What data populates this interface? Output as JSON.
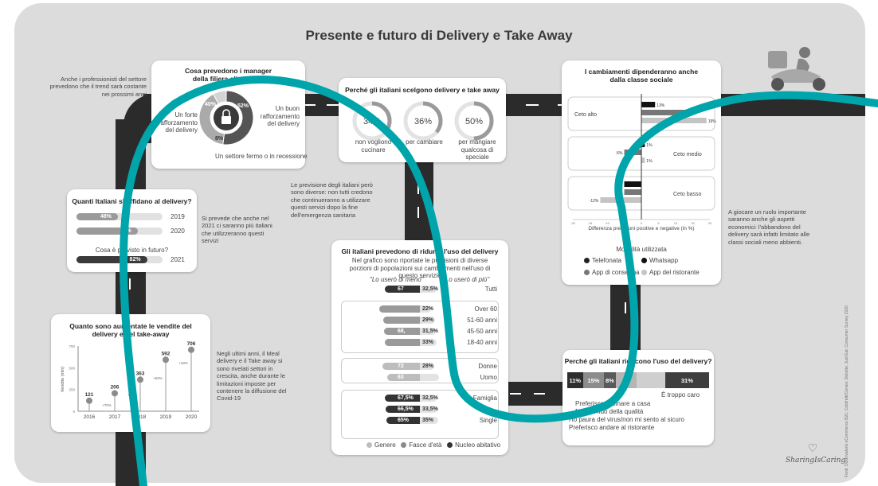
{
  "title": "Presente e futuro di Delivery e Take Away",
  "notes": {
    "professionals": "Anche i professionisti del settore prevedono che il trend sarà costante nei prossimi anni",
    "forecast_2021": "Si prevede che anche nel 2021 ci saranno più italiani che utilizzeranno questi servizi",
    "meal_delivery": "Negli ultimi anni, il Meal delivery e il Take away si sono rivelati settori in crescita, anche durante le limitazioni imposte per contenere la diffusione del Covid-19",
    "previsions": "Le previsione degli italiani però sono diverse: non tutti credono che continueranno a utilizzare questi servizi dopo la fine dell'emergenza sanitaria",
    "economic": "A giocare un ruolo importante saranno anche gli aspetti economici: l'abbandono del delivery sarà infatti limitato alle classi sociali meno abbienti."
  },
  "managers": {
    "title": "Cosa prevedono i manager della filiera alimentare",
    "slices": [
      {
        "label": "Un buon rafforzamento del delivery",
        "value": "52%",
        "color": "#555555"
      },
      {
        "label": "Un forte rafforzamento del delivery",
        "value": "40%",
        "color": "#aaaaaa"
      },
      {
        "label": "Un settore fermo o in recessione",
        "value": "8%",
        "color": "#d4d4d4"
      }
    ]
  },
  "reasons": {
    "title": "Perché gli italiani scelgono delivery e take away",
    "items": [
      {
        "value": "34%",
        "label": "non vogliono cucinare",
        "pct": 34
      },
      {
        "value": "36%",
        "label": "per cambiare",
        "pct": 36
      },
      {
        "value": "50%",
        "label": "per mangiare qualcosa di speciale",
        "pct": 50
      }
    ]
  },
  "trust": {
    "title": "Quanti Italiani si affidano al delivery?",
    "rows": [
      {
        "value": "48%",
        "year": "2019",
        "pct": 48,
        "color": "#9a9a9a"
      },
      {
        "value": "71%",
        "year": "2020",
        "pct": 71,
        "color": "#9a9a9a"
      },
      {
        "value": "82%",
        "year": "2021",
        "pct": 82,
        "color": "#3a3a3a"
      }
    ],
    "question": "Cosa è previsto in futuro?"
  },
  "sales": {
    "title": "Quanto sono aumentate le vendite del delivery e del take-away",
    "ylabel": "Vendite (mln)"
  },
  "future": {
    "title": "Gli italiani prevedono di ridurre l'uso del delivery",
    "subtitle": "Nel grafico sono riportate le previsioni di diverse porzioni di popolazioni sui cambiamenti nell'uso di questo servizio",
    "less_label": "\"Lo userò di meno\"",
    "more_label": "\"Lo userò di più\"",
    "legend": [
      "Genere",
      "Fasce d'età",
      "Nucleo abitativo"
    ]
  },
  "social": {
    "title": "I cambiamenti dipenderanno anche dalla classe sociale",
    "axis_label": "Differenza previsioni positive e negative (in %)",
    "legend_title": "Modalità utilizzata",
    "legend": [
      "Telefonata",
      "Whatsapp",
      "App di consegna",
      "App del ristorante"
    ]
  },
  "reduce": {
    "title": "Perché gli italiani riducono l'uso del delivery?",
    "segments": [
      {
        "value": "11%",
        "color": "#2e2e2e",
        "w": 11
      },
      {
        "value": "15%",
        "color": "#8c8c8c",
        "w": 15
      },
      {
        "value": "8%",
        "color": "#5a5a5a",
        "w": 8
      },
      {
        "value": "",
        "color": "#b5b5b5",
        "w": 15
      },
      {
        "value": "",
        "color": "#cfcfcf",
        "w": 20
      },
      {
        "value": "31%",
        "color": "#3e3e3e",
        "w": 31
      }
    ],
    "labels": [
      "È troppo caro",
      "Preferisco cucinare a casa",
      "Non mi fido della qualità",
      "Ho paura del virus/non mi sento al sicuro",
      "Preferisco andare al ristorante"
    ]
  },
  "brand": "SharingIsCaring",
  "source": "Fonti: Osservatorio eCommerce B2c; Coldiretti/Censis; Deloitte; Just Eat; Consumer Survey 2020",
  "chart_data": [
    {
      "type": "pie",
      "title": "Cosa prevedono i manager della filiera alimentare",
      "labels": [
        "Un buon rafforzamento del delivery",
        "Un forte rafforzamento del delivery",
        "Un settore fermo o in recessione"
      ],
      "values": [
        52,
        40,
        8
      ]
    },
    {
      "type": "bar",
      "title": "Quanti Italiani si affidano al delivery?",
      "categories": [
        "2019",
        "2020",
        "2021"
      ],
      "values": [
        48,
        71,
        82
      ]
    },
    {
      "type": "line",
      "title": "Quanto sono aumentate le vendite del delivery e del take-away",
      "ylabel": "Vendite (mln)",
      "x": [
        "2016",
        "2017",
        "2018",
        "2019",
        "2020"
      ],
      "values": [
        121,
        206,
        363,
        592,
        706
      ],
      "growth_labels": [
        "+70%",
        "+76%",
        "+63%",
        "+19%"
      ],
      "ylim": [
        0,
        750
      ],
      "yticks": [
        0,
        250,
        500,
        750
      ]
    },
    {
      "type": "bar",
      "title": "Gli italiani prevedono di ridurre l'uso del delivery",
      "groups": [
        {
          "group": "",
          "rows": [
            {
              "label": "Tutti",
              "less": 67.5,
              "more": 32.5,
              "less_text": "67",
              "more_text": "32,5%"
            }
          ]
        },
        {
          "group": "Fasce d'età",
          "rows": [
            {
              "label": "Over 60",
              "less": 78,
              "more": 22,
              "less_text": "",
              "more_text": "22%"
            },
            {
              "label": "51-60 anni",
              "less": 71,
              "more": 29,
              "less_text": "",
              "more_text": "29%"
            },
            {
              "label": "45-50 anni",
              "less": 68.5,
              "more": 31.5,
              "less_text": "68,",
              "more_text": "31,5%"
            },
            {
              "label": "18-40 anni",
              "less": 67,
              "more": 33,
              "less_text": "",
              "more_text": "33%"
            }
          ]
        },
        {
          "group": "Genere",
          "rows": [
            {
              "label": "Donne",
              "less": 72,
              "more": 28,
              "less_text": "72",
              "more_text": "28%"
            },
            {
              "label": "Uomo",
              "less": 63,
              "more": 37,
              "less_text": "63",
              "more_text": ""
            }
          ]
        },
        {
          "group": "Nucleo abitativo",
          "rows": [
            {
              "label": "Famiglia",
              "less": 67.5,
              "more": 32.5,
              "less_text": "67,5%",
              "more_text": "32,5%"
            },
            {
              "label": "",
              "less": 66.5,
              "more": 33.5,
              "less_text": "66,5%",
              "more_text": "33,5%"
            },
            {
              "label": "Single",
              "less": 65,
              "more": 35,
              "less_text": "65%",
              "more_text": "35%"
            }
          ]
        }
      ]
    },
    {
      "type": "bar",
      "title": "I cambiamenti dipenderanno anche dalla classe sociale",
      "categories": [
        "Ceto alto",
        "Ceto medio",
        "Ceto basso"
      ],
      "series": [
        {
          "name": "Telefonata",
          "values": [
            null,
            null,
            null
          ]
        },
        {
          "name": "Whatsapp",
          "values": [
            4,
            1,
            -5
          ]
        },
        {
          "name": "App di consegna",
          "values": [
            13,
            -5,
            -5
          ]
        },
        {
          "name": "App del ristorante",
          "values": [
            19,
            1,
            -12
          ]
        }
      ],
      "printed_values": [
        [
          "13%",
          "4%",
          "19%"
        ],
        [
          "1%",
          "-5%",
          "1%"
        ],
        [
          "-5%",
          "-5%",
          "-12%"
        ]
      ],
      "xlim": [
        -20,
        20
      ],
      "xticks": [
        -20,
        -15,
        -10,
        -5,
        0,
        5,
        10,
        15,
        20
      ]
    },
    {
      "type": "bar",
      "title": "Perché gli italiani riducono l'uso del delivery?",
      "values_shown": [
        "11%",
        "15%",
        "8%",
        "31%"
      ],
      "categories": [
        "È troppo caro",
        "Preferisco cucinare a casa",
        "Non mi fido della qualità",
        "Ho paura del virus/non mi sento al sicuro",
        "Preferisco andare al ristorante"
      ]
    }
  ]
}
